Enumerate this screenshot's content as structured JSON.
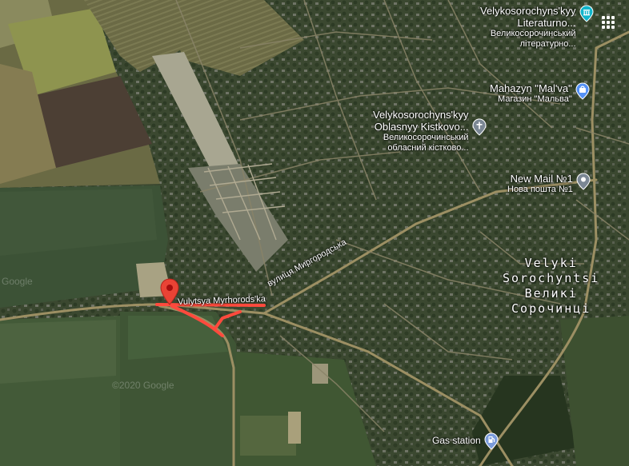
{
  "map": {
    "type": "satellite",
    "watermarks": [
      "Google",
      "©2020 Google"
    ],
    "accent_color": "#ea4335",
    "route_color": "#ff4a3d"
  },
  "places": {
    "museum": {
      "name_en_1": "Velykosorochyns'kyy",
      "name_en_2": "Literaturno...",
      "name_ua_1": "Великосорочинський",
      "name_ua_2": "літературно...",
      "icon": "museum-icon",
      "color": "#12b5cb"
    },
    "store": {
      "name_en": "Mahazyn \"Mal'va\"",
      "name_ua": "Магазин \"Мальва\"",
      "icon": "shopping-bag-icon",
      "color": "#5491f5"
    },
    "church": {
      "name_en_1": "Velykosorochyns'kyy",
      "name_en_2": "Oblasnyy Kistkovo...",
      "name_ua_1": "Великосорочинський",
      "name_ua_2": "обласний кістково...",
      "icon": "cross-icon",
      "color": "#7b8794"
    },
    "post": {
      "name_en": "New Mail №1",
      "name_ua": "Нова пошта №1",
      "icon": "location-pin-icon",
      "color": "#7b8794"
    },
    "gas": {
      "name_en": "Gas station",
      "icon": "gas-pump-icon",
      "color": "#7b9cdb"
    }
  },
  "town": {
    "name_en_1": "Velyki",
    "name_en_2": "Sorochyntsi",
    "name_ua_1": "Великі",
    "name_ua_2": "Сорочинці"
  },
  "streets": {
    "myrhorodska_ua": "вулиця Миргородська",
    "myrhorodska_en": "Vulytsya Myrhorods'ka"
  },
  "marker": {
    "icon": "red-location-marker-icon"
  },
  "controls": {
    "apps_icon": "apps-grid-icon"
  }
}
